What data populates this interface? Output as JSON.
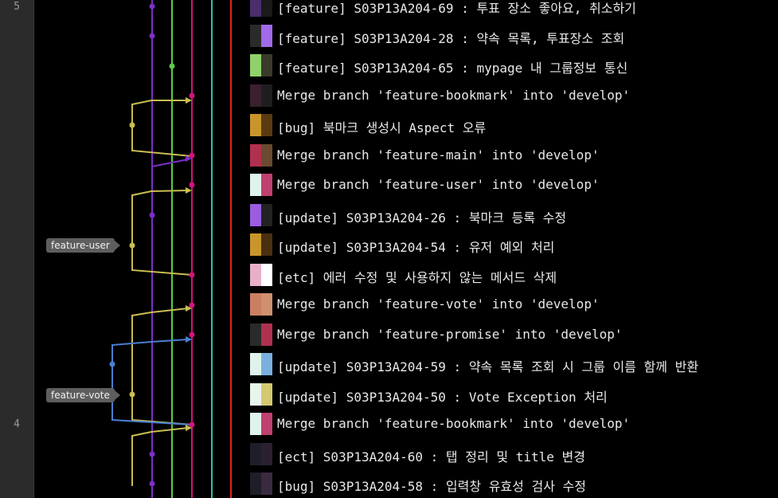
{
  "gutter": {
    "numbers": [
      "5",
      "4"
    ]
  },
  "branch_tags": [
    "feature-user",
    "feature-vote"
  ],
  "commits": [
    {
      "message": "[feature] S03P13A204-69 : 투표 장소 좋아요, 취소하기",
      "avatar": [
        "#4a2d6b",
        "#1a1a1a"
      ]
    },
    {
      "message": "[feature] S03P13A204-28 : 약속 목록, 투표장소 조회",
      "avatar": [
        "#2a2a2a",
        "#a16ae8"
      ]
    },
    {
      "message": "[feature] S03P13A204-65 : mypage 내 그룹정보 통신",
      "avatar": [
        "#8fd16a",
        "#3a3a2a"
      ]
    },
    {
      "message": "Merge branch 'feature-bookmark' into 'develop'",
      "avatar": [
        "#3a2030",
        "#1e1e1e"
      ]
    },
    {
      "message": "[bug] 북마크 생성시 Aspect 오류",
      "avatar": [
        "#c9952b",
        "#5a3a10"
      ]
    },
    {
      "message": "Merge branch 'feature-main' into 'develop'",
      "avatar": [
        "#b03050",
        "#6a4a30"
      ]
    },
    {
      "message": "Merge branch 'feature-user' into 'develop'",
      "avatar": [
        "#dff3ec",
        "#c04070"
      ]
    },
    {
      "message": "[update] S03P13A204-26 : 북마크 등록 수정",
      "avatar": [
        "#9a5ce0",
        "#222222"
      ]
    },
    {
      "message": "[update] S03P13A204-54 : 유저 예외 처리",
      "avatar": [
        "#c9952b",
        "#4a3010"
      ]
    },
    {
      "message": "[etc] 에러 수정 및 사용하지 않는 메서드 삭제",
      "avatar": [
        "#e8b0c8",
        "#ffffff"
      ]
    },
    {
      "message": "Merge branch 'feature-vote' into 'develop'",
      "avatar": [
        "#c98060",
        "#d09070"
      ]
    },
    {
      "message": "Merge branch 'feature-promise' into 'develop'",
      "avatar": [
        "#2a2a2a",
        "#b03050"
      ]
    },
    {
      "message": "[update] S03P13A204-59 : 약속 목록 조회 시 그룹 이름 함께 반환",
      "avatar": [
        "#dff3ec",
        "#7ab0e0"
      ]
    },
    {
      "message": "[update] S03P13A204-50 : Vote Exception 처리",
      "avatar": [
        "#e8f5ec",
        "#d4c870"
      ]
    },
    {
      "message": "Merge branch 'feature-bookmark' into 'develop'",
      "avatar": [
        "#dff3ec",
        "#c04070"
      ]
    },
    {
      "message": "[ect] S03P13A204-60 : 탭 정리 및 title 변경",
      "avatar": [
        "#1e1e28",
        "#2a2030"
      ]
    },
    {
      "message": "[bug] S03P13A204-58 : 입력창 유효성 검사 수정",
      "avatar": [
        "#1e1e28",
        "#3a2a40"
      ]
    }
  ],
  "graph_colors": {
    "purple": "#7b2fc8",
    "green": "#5cc94a",
    "magenta": "#d0157c",
    "teal": "#2ec4a8",
    "red": "#e02424",
    "olive": "#c9bd52",
    "blue": "#4a7fd1"
  }
}
